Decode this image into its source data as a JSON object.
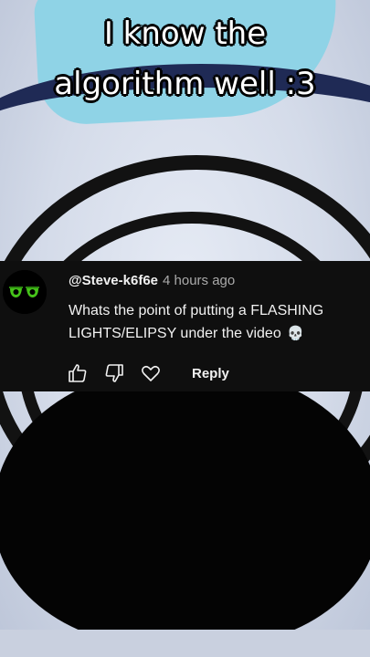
{
  "caption": {
    "line1": "I know the",
    "line2": "algorithm well :3"
  },
  "comment": {
    "handle": "@Steve-k6f6e",
    "time": "4 hours ago",
    "text": "Whats the point of putting a FLASHING LIGHTS/ELIPSY under the video",
    "emoji": "💀",
    "reply_label": "Reply"
  },
  "colors": {
    "comment_bg": "#0f0f0f",
    "avatar_eye": "#46c41a",
    "caption_text": "#ffffff"
  }
}
